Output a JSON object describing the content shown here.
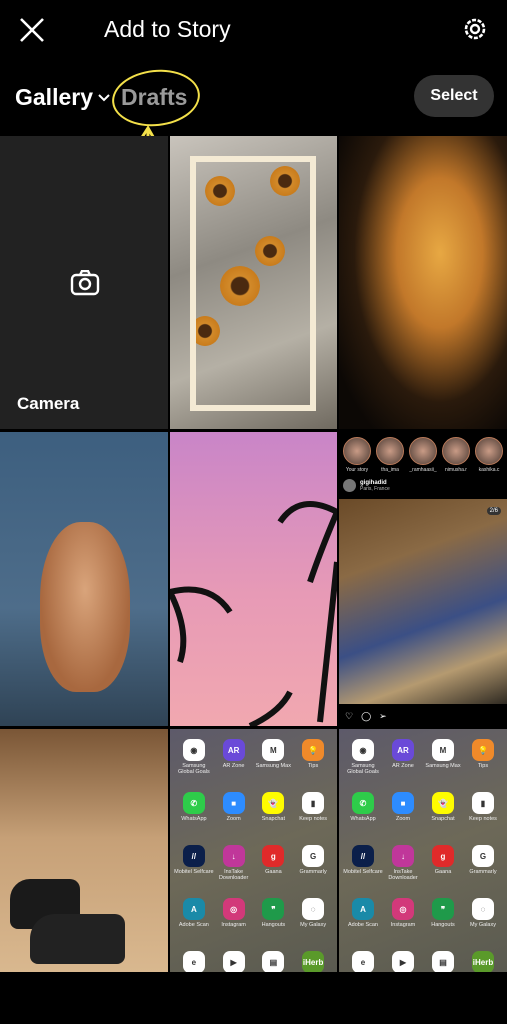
{
  "header": {
    "title": "Add to Story",
    "close_icon": "close-icon",
    "settings_icon": "gear-icon"
  },
  "tabs": {
    "gallery": "Gallery",
    "drafts": "Drafts",
    "select": "Select"
  },
  "annotation": {
    "color": "#f3e04a"
  },
  "camera": {
    "label": "Camera"
  },
  "story_preview": {
    "stories": [
      "Your story",
      "tha_ima",
      "_ramhaasii_",
      "nimusha.r",
      "kashika.c"
    ],
    "post_user": "gigihadid",
    "post_location": "Paris, France",
    "page_indicator": "2/6"
  },
  "apps": [
    {
      "label": "Samsung Global Goals",
      "glyph": "◉",
      "color": "#ffffff"
    },
    {
      "label": "AR Zone",
      "glyph": "AR",
      "color": "#6a4ad8"
    },
    {
      "label": "Samsung Max",
      "glyph": "M",
      "color": "#ffffff"
    },
    {
      "label": "Tips",
      "glyph": "💡",
      "color": "#f08a2a"
    },
    {
      "label": "WhatsApp",
      "glyph": "✆",
      "color": "#2ecc4a"
    },
    {
      "label": "Zoom",
      "glyph": "■",
      "color": "#2d8cff"
    },
    {
      "label": "Snapchat",
      "glyph": "👻",
      "color": "#fffc00"
    },
    {
      "label": "Keep notes",
      "glyph": "▮",
      "color": "#ffffff"
    },
    {
      "label": "Mobitel Selfcare",
      "glyph": "//",
      "color": "#0b1f4a"
    },
    {
      "label": "InsTake Downloader",
      "glyph": "↓",
      "color": "#c0379a"
    },
    {
      "label": "Gaana",
      "glyph": "g",
      "color": "#e02a2a"
    },
    {
      "label": "Grammarly",
      "glyph": "G",
      "color": "#ffffff"
    },
    {
      "label": "Adobe Scan",
      "glyph": "A",
      "color": "#1a8aa8"
    },
    {
      "label": "Instagram",
      "glyph": "◎",
      "color": "#d2397a"
    },
    {
      "label": "Hangouts",
      "glyph": "❞",
      "color": "#1f9a4a"
    },
    {
      "label": "My Galaxy",
      "glyph": "◌",
      "color": "#ffffff"
    },
    {
      "label": "eChannelling",
      "glyph": "e",
      "color": "#ffffff"
    },
    {
      "label": "Meet",
      "glyph": "▶",
      "color": "#ffffff"
    },
    {
      "label": "PDF Converter",
      "glyph": "▤",
      "color": "#ffffff"
    },
    {
      "label": "iHerb",
      "glyph": "iHerb",
      "color": "#5a9a2a"
    }
  ]
}
